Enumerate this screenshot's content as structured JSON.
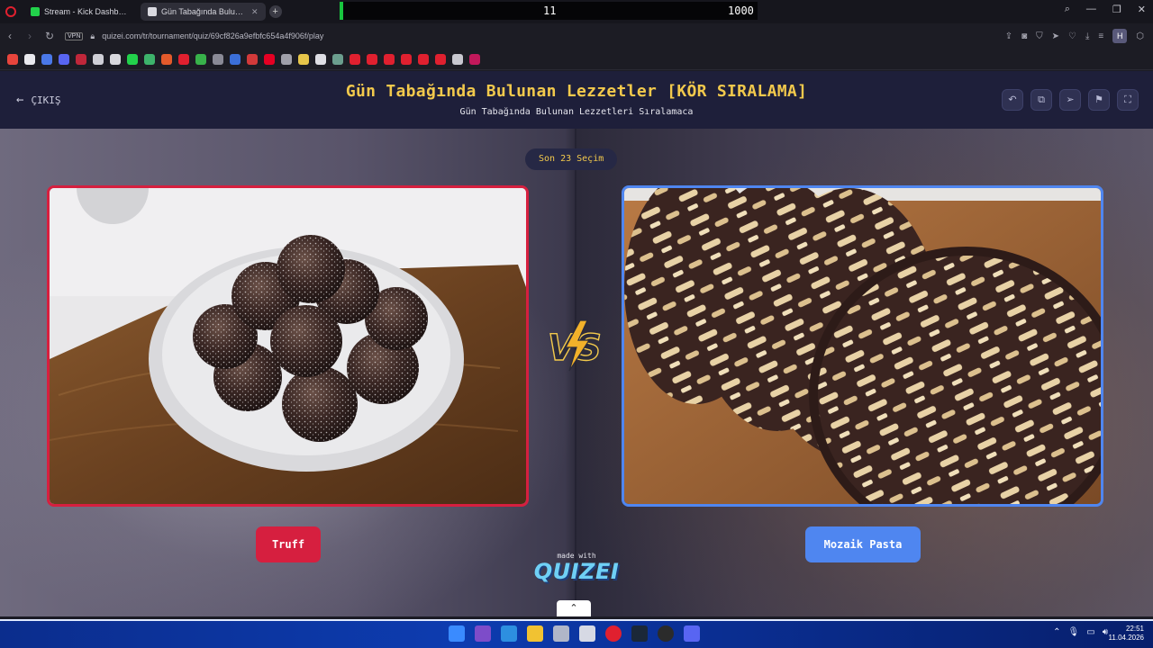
{
  "browser": {
    "tabs": [
      {
        "label": "Stream - Kick Dashboard",
        "favicon_color": "#22d14b",
        "active": false
      },
      {
        "label": "Gün Tabağında Bulunan L",
        "favicon_color": "#d9d9e0",
        "active": true
      }
    ],
    "new_tab_label": "+",
    "overlay_counter_1": "11",
    "overlay_counter_2": "1000",
    "url": "quizei.com/tr/tournament/quiz/69cf826a9efbfc654a4f906f/play",
    "vpn_label": "VPN",
    "profile_letter": "H"
  },
  "page": {
    "exit_label": "ÇIKIŞ",
    "title": "Gün Tabağında Bulunan Lezzetler [KÖR SIRALAMA]",
    "subtitle": "Gün Tabağında Bulunan Lezzetleri Sıralamaca",
    "round_pill": "Son 23 Seçim",
    "vs_label": "VS",
    "left_choice": "Truff",
    "right_choice": "Mozaik Pasta",
    "made_with": "made with",
    "brand": "QUIZEI"
  },
  "taskbar": {
    "time": "22:51",
    "date": "11.04.2026"
  },
  "colors": {
    "title_yellow": "#f2c94c",
    "left_accent": "#d61f3f",
    "right_accent": "#4f86f0",
    "nav_bg": "#1e1f3a"
  }
}
